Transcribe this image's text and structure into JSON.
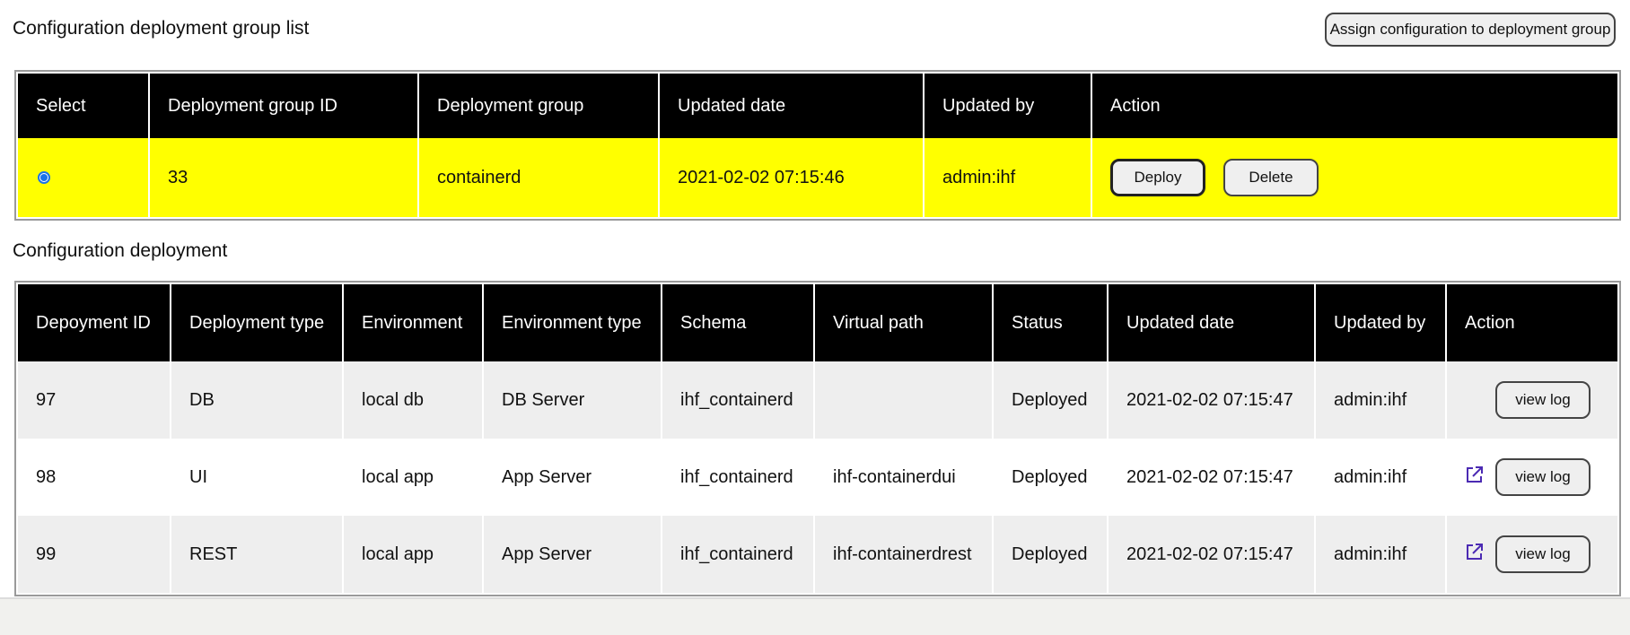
{
  "group_list": {
    "title": "Configuration deployment group list",
    "assign_button": "Assign configuration to deployment group",
    "columns": [
      "Select",
      "Deployment group ID",
      "Deployment group",
      "Updated date",
      "Updated by",
      "Action"
    ],
    "rows": [
      {
        "selected": true,
        "id": "33",
        "group": "containerd",
        "updated_date": "2021-02-02 07:15:46",
        "updated_by": "admin:ihf",
        "deploy_label": "Deploy",
        "delete_label": "Delete"
      }
    ],
    "highlight_color": "#ffff00"
  },
  "deployment": {
    "title": "Configuration deployment",
    "columns": [
      "Depoyment ID",
      "Deployment type",
      "Environment",
      "Environment type",
      "Schema",
      "Virtual path",
      "Status",
      "Updated date",
      "Updated by",
      "Action"
    ],
    "rows": [
      {
        "id": "97",
        "type": "DB",
        "environment": "local db",
        "env_type": "DB Server",
        "schema": "ihf_containerd",
        "virtual_path": "",
        "status": "Deployed",
        "updated_date": "2021-02-02 07:15:47",
        "updated_by": "admin:ihf",
        "has_link": false,
        "log_label": "view log"
      },
      {
        "id": "98",
        "type": "UI",
        "environment": "local app",
        "env_type": "App Server",
        "schema": "ihf_containerd",
        "virtual_path": "ihf-containerdui",
        "status": "Deployed",
        "updated_date": "2021-02-02 07:15:47",
        "updated_by": "admin:ihf",
        "has_link": true,
        "log_label": "view log"
      },
      {
        "id": "99",
        "type": "REST",
        "environment": "local app",
        "env_type": "App Server",
        "schema": "ihf_containerd",
        "virtual_path": "ihf-containerdrest",
        "status": "Deployed",
        "updated_date": "2021-02-02 07:15:47",
        "updated_by": "admin:ihf",
        "has_link": true,
        "log_label": "view log"
      }
    ],
    "link_icon": "external-link-icon",
    "link_color": "#4b2ab3"
  }
}
